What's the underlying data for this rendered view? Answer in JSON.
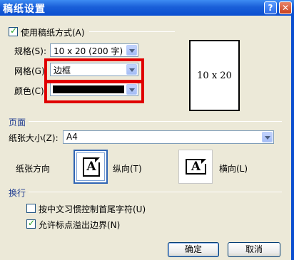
{
  "window": {
    "title": "稿纸设置"
  },
  "titlebar": {
    "help_label": "?",
    "close_label": "✕"
  },
  "use_manuscript": {
    "label": "使用稿纸方式(A)",
    "checked": true
  },
  "spec": {
    "label": "规格(S):",
    "value": "10 x 20 (200 字)"
  },
  "grid": {
    "label": "网格(G):",
    "value": "边框"
  },
  "color": {
    "label": "颜色(C):",
    "value": "#000000"
  },
  "preview": {
    "text": "10 x 20"
  },
  "page_section": {
    "title": "页面"
  },
  "paper_size": {
    "label": "纸张大小(Z):",
    "value": "A4"
  },
  "orientation": {
    "label": "纸张方向",
    "portrait_label": "纵向(T)",
    "landscape_label": "横向(L)",
    "icon_letter": "A",
    "selected": "portrait"
  },
  "wrap_section": {
    "title": "换行"
  },
  "options": [
    {
      "label": "按中文习惯控制首尾字符(U)",
      "checked": false
    },
    {
      "label": "允许标点溢出边界(N)",
      "checked": true
    }
  ],
  "buttons": {
    "ok": "确定",
    "cancel": "取消"
  },
  "highlight_color": "#e00000"
}
